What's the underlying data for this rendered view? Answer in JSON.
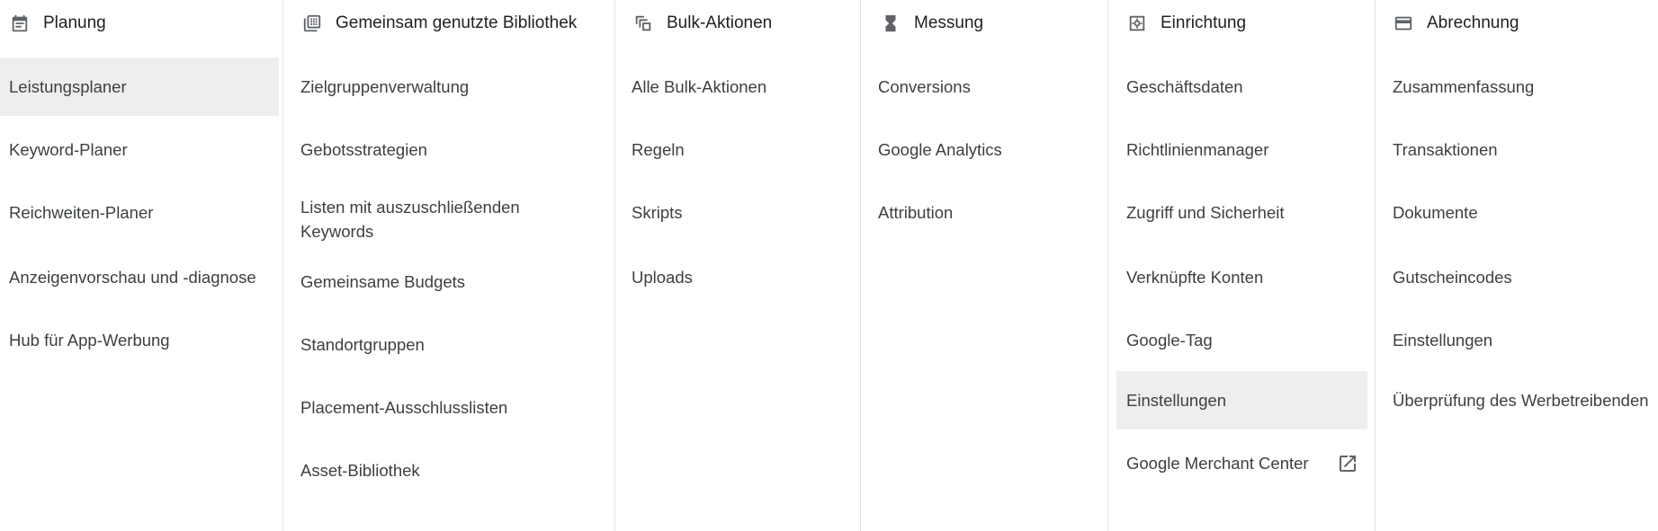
{
  "columns": [
    {
      "title": "Planung",
      "icon": "calendar-icon",
      "items": [
        {
          "label": "Leistungsplaner",
          "selected": true
        },
        {
          "label": "Keyword-Planer"
        },
        {
          "label": "Reichweiten-Planer"
        },
        {
          "label": "Anzeigenvorschau und -diagnose"
        },
        {
          "label": "Hub für App-Werbung"
        }
      ]
    },
    {
      "title": "Gemeinsam genutzte Bibliothek",
      "icon": "library-icon",
      "items": [
        {
          "label": "Zielgruppenverwaltung"
        },
        {
          "label": "Gebotsstrategien"
        },
        {
          "label": "Listen mit auszuschließenden Keywords"
        },
        {
          "label": "Gemeinsame Budgets"
        },
        {
          "label": "Standortgruppen"
        },
        {
          "label": "Placement-Ausschlusslisten"
        },
        {
          "label": "Asset-Bibliothek"
        }
      ]
    },
    {
      "title": "Bulk-Aktionen",
      "icon": "copy-stack-icon",
      "items": [
        {
          "label": "Alle Bulk-Aktionen"
        },
        {
          "label": "Regeln"
        },
        {
          "label": "Skripts"
        },
        {
          "label": "Uploads"
        }
      ]
    },
    {
      "title": "Messung",
      "icon": "hourglass-icon",
      "items": [
        {
          "label": "Conversions"
        },
        {
          "label": "Google Analytics"
        },
        {
          "label": "Attribution"
        }
      ]
    },
    {
      "title": "Einrichtung",
      "icon": "settings-icon",
      "items": [
        {
          "label": "Geschäftsdaten"
        },
        {
          "label": "Richtlinienmanager"
        },
        {
          "label": "Zugriff und Sicherheit"
        },
        {
          "label": "Verknüpfte Konten"
        },
        {
          "label": "Google-Tag"
        },
        {
          "label": "Einstellungen",
          "selected": true
        },
        {
          "label": "Google Merchant Center",
          "external": true,
          "external_icon": "open-in-new-icon"
        }
      ]
    },
    {
      "title": "Abrechnung",
      "icon": "credit-card-icon",
      "items": [
        {
          "label": "Zusammenfassung"
        },
        {
          "label": "Transaktionen"
        },
        {
          "label": "Dokumente"
        },
        {
          "label": "Gutscheincodes"
        },
        {
          "label": "Einstellungen"
        },
        {
          "label": "Überprüfung des Werbetreibenden"
        }
      ]
    }
  ],
  "colors": {
    "text": "#3c4043",
    "header_text": "#202124",
    "icon": "#5f6368",
    "selected_bg": "#eeeeee",
    "divider": "#e3e3e3"
  }
}
